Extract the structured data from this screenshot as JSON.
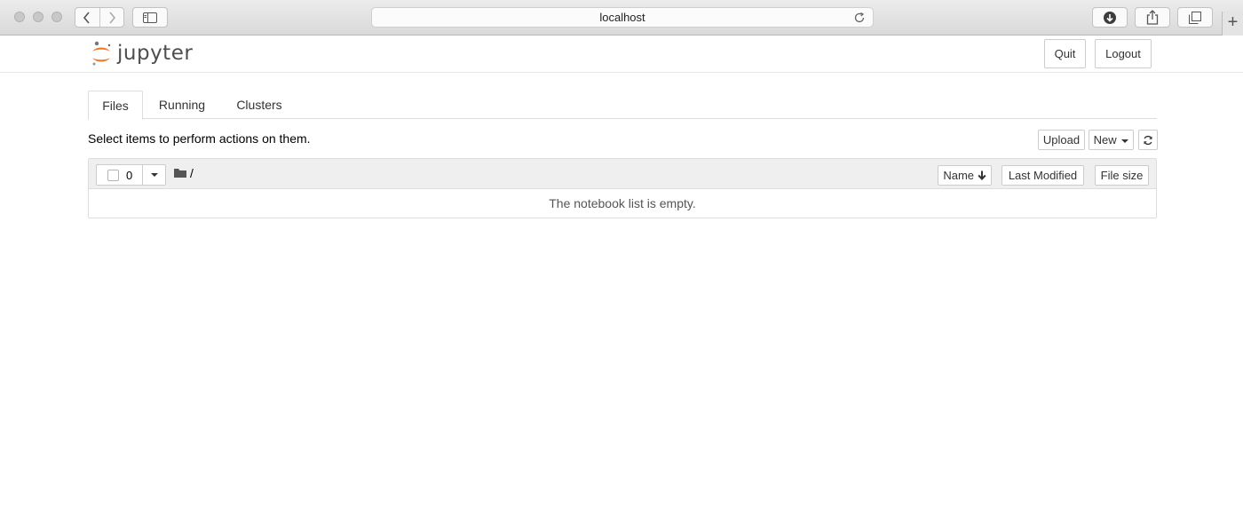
{
  "browser": {
    "url": "localhost",
    "icons": [
      "back-icon",
      "forward-icon",
      "sidebar-icon",
      "reload-icon",
      "download-icon",
      "share-icon",
      "tabs-icon",
      "new-tab-icon"
    ],
    "new_tab_label": "+"
  },
  "header": {
    "logo_text": "jupyter",
    "quit_label": "Quit",
    "logout_label": "Logout"
  },
  "tabs": [
    {
      "label": "Files",
      "active": true
    },
    {
      "label": "Running",
      "active": false
    },
    {
      "label": "Clusters",
      "active": false
    }
  ],
  "toolbar": {
    "instructions": "Select items to perform actions on them.",
    "upload_label": "Upload",
    "new_label": "New",
    "refresh_icon": "refresh-icon"
  },
  "list": {
    "selected_count": "0",
    "breadcrumb": "/",
    "sort_name_label": "Name",
    "sort_modified_label": "Last Modified",
    "sort_size_label": "File size",
    "empty_message": "The notebook list is empty."
  },
  "colors": {
    "logo_orange": "#f37726",
    "text": "#000000",
    "border": "#cccccc",
    "list_header_bg": "#efefef"
  }
}
